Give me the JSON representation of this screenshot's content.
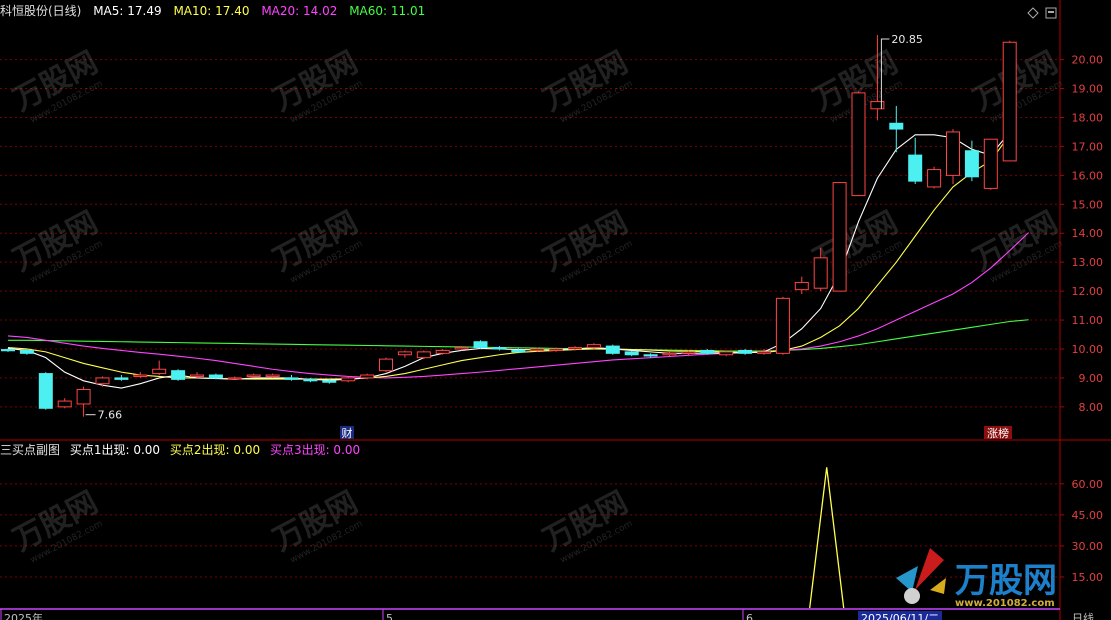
{
  "header": {
    "stock_name": "科恒股份(日线)",
    "ma5": {
      "label": "MA5: 17.49",
      "color": "#ffffff"
    },
    "ma10": {
      "label": "MA10: 17.40",
      "color": "#ffff4c"
    },
    "ma20": {
      "label": "MA20: 14.02",
      "color": "#ff44ff"
    },
    "ma60": {
      "label": "MA60: 11.01",
      "color": "#44ff44"
    }
  },
  "indicator": {
    "name": "三买点副图",
    "buy1": {
      "label": "买点1出现: 0.00",
      "color": "#ffffff"
    },
    "buy2": {
      "label": "买点2出现: 0.00",
      "color": "#ffff4c"
    },
    "buy3": {
      "label": "买点3出现: 0.00",
      "color": "#ff44ff"
    }
  },
  "price_axis": {
    "ticks": [
      "20.00",
      "19.00",
      "18.00",
      "17.00",
      "16.00",
      "15.00",
      "14.00",
      "13.00",
      "12.00",
      "11.00",
      "10.00",
      "9.00",
      "8.00"
    ],
    "range": [
      7.2,
      21.3
    ]
  },
  "indicator_axis": {
    "ticks": [
      "60.00",
      "45.00",
      "30.00",
      "15.00"
    ],
    "range": [
      0,
      72
    ]
  },
  "annotations": {
    "high_label": "20.85",
    "low_label": "7.66",
    "event_cai": "财",
    "event_zhangbang": "涨榜"
  },
  "time_axis": {
    "start": "2025年",
    "mark1": "5",
    "mark2": "6",
    "cursor_date": "2025/06/11/二",
    "period": "日线"
  },
  "watermark": {
    "text": "万股网",
    "url": "www.201082.com"
  },
  "colors": {
    "up": "#ff4444",
    "down": "#4cf0f0",
    "grid": "#7a0000",
    "axis": "#b00000"
  },
  "chart_data": {
    "type": "candlestick",
    "candles": [
      [
        9.98,
        10.02,
        9.9,
        9.95
      ],
      [
        9.95,
        10.0,
        9.8,
        9.85
      ],
      [
        9.15,
        9.2,
        7.9,
        7.95
      ],
      [
        8.0,
        8.3,
        7.95,
        8.2
      ],
      [
        8.1,
        8.7,
        7.66,
        8.6
      ],
      [
        8.8,
        9.05,
        8.7,
        9.0
      ],
      [
        9.0,
        9.1,
        8.9,
        8.95
      ],
      [
        9.05,
        9.2,
        9.0,
        9.1
      ],
      [
        9.15,
        9.6,
        9.1,
        9.3
      ],
      [
        9.25,
        9.3,
        8.9,
        8.95
      ],
      [
        9.05,
        9.2,
        9.0,
        9.1
      ],
      [
        9.1,
        9.15,
        8.95,
        9.0
      ],
      [
        8.98,
        9.05,
        8.95,
        9.0
      ],
      [
        9.05,
        9.15,
        9.0,
        9.1
      ],
      [
        9.05,
        9.15,
        9.0,
        9.1
      ],
      [
        9.0,
        9.1,
        8.9,
        8.95
      ],
      [
        8.95,
        9.0,
        8.85,
        8.9
      ],
      [
        8.9,
        8.95,
        8.8,
        8.85
      ],
      [
        8.9,
        9.05,
        8.85,
        9.0
      ],
      [
        9.0,
        9.15,
        8.95,
        9.1
      ],
      [
        9.25,
        9.7,
        9.2,
        9.65
      ],
      [
        9.8,
        9.95,
        9.7,
        9.9
      ],
      [
        9.7,
        9.95,
        9.65,
        9.9
      ],
      [
        9.85,
        10.0,
        9.8,
        9.95
      ],
      [
        10.0,
        10.1,
        9.95,
        10.05
      ],
      [
        10.25,
        10.3,
        10.0,
        10.05
      ],
      [
        10.05,
        10.1,
        9.95,
        10.0
      ],
      [
        9.95,
        10.05,
        9.85,
        9.9
      ],
      [
        9.95,
        10.05,
        9.9,
        10.0
      ],
      [
        9.95,
        10.05,
        9.9,
        10.0
      ],
      [
        10.0,
        10.1,
        9.95,
        10.05
      ],
      [
        10.05,
        10.2,
        10.0,
        10.15
      ],
      [
        10.1,
        10.15,
        9.8,
        9.85
      ],
      [
        9.9,
        9.95,
        9.75,
        9.8
      ],
      [
        9.8,
        9.85,
        9.7,
        9.78
      ],
      [
        9.8,
        9.9,
        9.75,
        9.85
      ],
      [
        9.85,
        9.95,
        9.75,
        9.9
      ],
      [
        9.95,
        10.0,
        9.8,
        9.85
      ],
      [
        9.8,
        9.95,
        9.75,
        9.9
      ],
      [
        9.95,
        10.0,
        9.8,
        9.85
      ],
      [
        9.85,
        10.0,
        9.8,
        9.9
      ],
      [
        9.85,
        11.8,
        9.8,
        11.75
      ],
      [
        12.05,
        12.5,
        11.9,
        12.3
      ],
      [
        12.1,
        13.5,
        12.0,
        13.15
      ],
      [
        12.0,
        14.2,
        12.0,
        15.75
      ],
      [
        15.3,
        18.9,
        15.3,
        18.85
      ],
      [
        18.3,
        20.85,
        17.9,
        18.55
      ],
      [
        17.8,
        18.4,
        16.8,
        17.6
      ],
      [
        16.7,
        17.3,
        15.7,
        15.8
      ],
      [
        15.6,
        16.3,
        15.55,
        16.2
      ],
      [
        16.0,
        17.6,
        15.7,
        17.5
      ],
      [
        16.85,
        17.2,
        15.8,
        15.95
      ],
      [
        15.55,
        17.25,
        15.5,
        17.25
      ],
      [
        16.5,
        20.65,
        16.5,
        20.6
      ]
    ],
    "ma5": [
      10.02,
      9.95,
      9.7,
      9.2,
      8.9,
      8.75,
      8.65,
      8.8,
      9.0,
      9.1,
      9.0,
      8.98,
      8.95,
      9.0,
      9.0,
      9.0,
      8.95,
      8.92,
      8.95,
      9.0,
      9.15,
      9.4,
      9.7,
      9.85,
      9.95,
      10.02,
      10.0,
      9.98,
      9.97,
      9.97,
      10.0,
      10.05,
      10.0,
      9.95,
      9.9,
      9.85,
      9.85,
      9.86,
      9.86,
      9.87,
      9.9,
      10.2,
      10.7,
      11.4,
      12.6,
      14.4,
      15.9,
      16.9,
      17.4,
      17.4,
      17.3,
      16.9,
      16.7,
      17.49
    ],
    "ma10": [
      10.05,
      10.0,
      9.9,
      9.7,
      9.5,
      9.35,
      9.2,
      9.1,
      9.05,
      9.0,
      9.0,
      8.98,
      8.97,
      8.96,
      8.96,
      8.96,
      8.96,
      8.96,
      8.97,
      9.0,
      9.05,
      9.15,
      9.3,
      9.45,
      9.6,
      9.7,
      9.8,
      9.88,
      9.92,
      9.95,
      9.98,
      10.0,
      10.0,
      9.98,
      9.96,
      9.93,
      9.92,
      9.91,
      9.9,
      9.88,
      9.88,
      9.95,
      10.1,
      10.4,
      10.8,
      11.4,
      12.2,
      13.0,
      13.9,
      14.8,
      15.6,
      16.1,
      16.5,
      17.4
    ],
    "ma20": [
      10.45,
      10.4,
      10.3,
      10.2,
      10.1,
      10.02,
      9.95,
      9.88,
      9.82,
      9.75,
      9.68,
      9.6,
      9.5,
      9.4,
      9.3,
      9.22,
      9.15,
      9.1,
      9.05,
      9.02,
      9.0,
      9.02,
      9.05,
      9.1,
      9.15,
      9.2,
      9.26,
      9.32,
      9.38,
      9.44,
      9.5,
      9.56,
      9.62,
      9.66,
      9.7,
      9.74,
      9.78,
      9.82,
      9.85,
      9.88,
      9.9,
      9.95,
      10.0,
      10.1,
      10.25,
      10.45,
      10.7,
      11.0,
      11.3,
      11.6,
      11.9,
      12.3,
      12.8,
      13.4,
      14.02
    ],
    "ma60": [
      10.3,
      10.3,
      10.29,
      10.28,
      10.27,
      10.26,
      10.25,
      10.24,
      10.23,
      10.22,
      10.21,
      10.2,
      10.19,
      10.18,
      10.17,
      10.16,
      10.15,
      10.14,
      10.13,
      10.12,
      10.11,
      10.1,
      10.09,
      10.08,
      10.07,
      10.06,
      10.05,
      10.04,
      10.03,
      10.02,
      10.01,
      10.0,
      9.99,
      9.98,
      9.97,
      9.96,
      9.95,
      9.94,
      9.93,
      9.93,
      9.93,
      9.95,
      9.98,
      10.02,
      10.08,
      10.15,
      10.25,
      10.35,
      10.45,
      10.55,
      10.65,
      10.75,
      10.85,
      10.95,
      11.01
    ],
    "indicator_spike": {
      "index": 43,
      "value": 68
    }
  }
}
